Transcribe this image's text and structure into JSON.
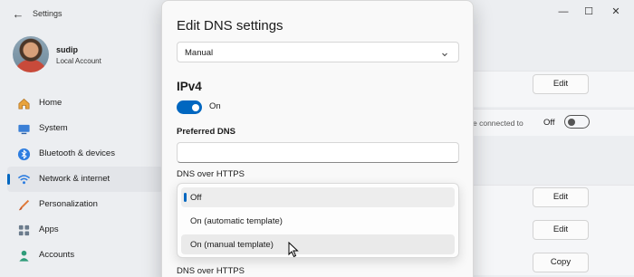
{
  "window": {
    "title": "Settings",
    "controls": [
      "—",
      "☐",
      "✕"
    ]
  },
  "profile": {
    "name": "sudip",
    "account_type": "Local Account"
  },
  "sidebar": {
    "items": [
      {
        "label": "Home",
        "icon": "home-icon",
        "active": false
      },
      {
        "label": "System",
        "icon": "system-icon",
        "active": false
      },
      {
        "label": "Bluetooth & devices",
        "icon": "bluetooth-icon",
        "active": false
      },
      {
        "label": "Network & internet",
        "icon": "network-icon",
        "active": true
      },
      {
        "label": "Personalization",
        "icon": "personalization-icon",
        "active": false
      },
      {
        "label": "Apps",
        "icon": "apps-icon",
        "active": false
      },
      {
        "label": "Accounts",
        "icon": "accounts-icon",
        "active": false
      }
    ]
  },
  "background": {
    "edit_label": "Edit",
    "connected_text": "e connected to",
    "off_label": "Off",
    "copy_label": "Copy"
  },
  "dialog": {
    "title": "Edit DNS settings",
    "mode_value": "Manual",
    "section": "IPv4",
    "toggle_label": "On",
    "preferred_dns_label": "Preferred DNS",
    "preferred_dns_value": "",
    "doh_label": "DNS over HTTPS",
    "doh_options": [
      "Off",
      "On (automatic template)",
      "On (manual template)"
    ],
    "doh_selected": "Off",
    "doh_label_secondary": "DNS over HTTPS"
  },
  "colors": {
    "accent": "#0067c0",
    "dialog_bg": "#f9f9f9",
    "window_bg": "#eceef1"
  }
}
